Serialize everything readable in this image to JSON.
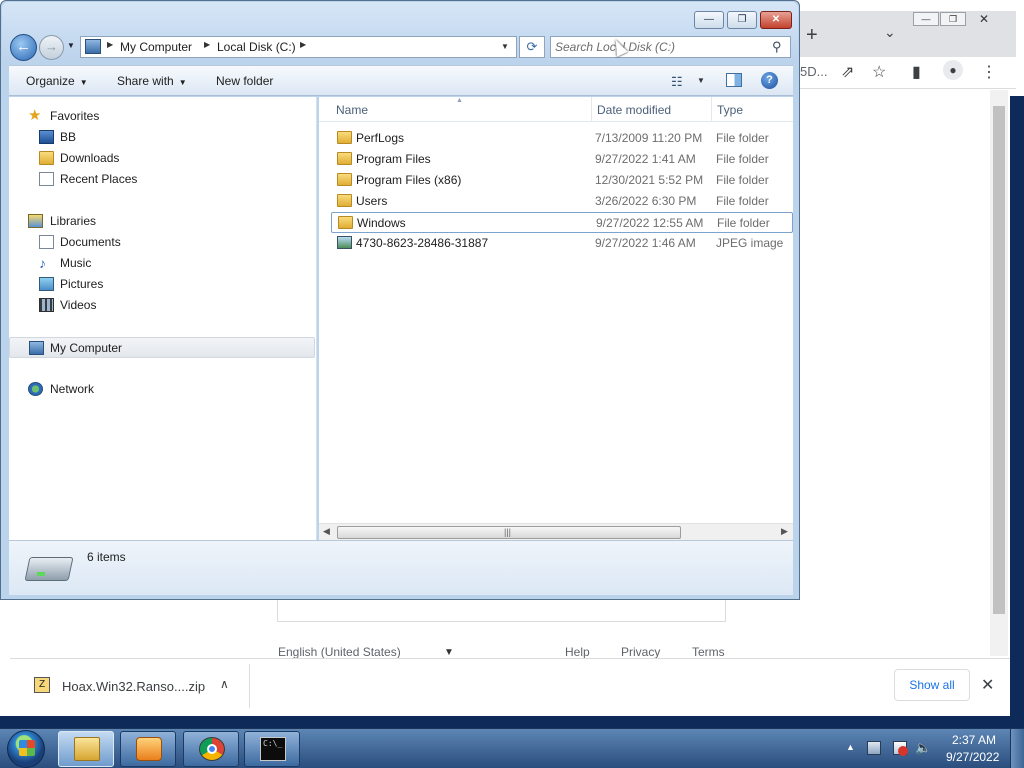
{
  "explorer": {
    "controls": {
      "minimize": "—",
      "maximize": "❐",
      "close": "✕"
    },
    "address": {
      "crumbs": [
        "My Computer",
        "Local Disk (C:)"
      ]
    },
    "search": {
      "placeholder": "Search Local Disk (C:)"
    },
    "toolbar": {
      "organize": "Organize",
      "share_with": "Share with",
      "new_folder": "New folder",
      "help": "?"
    },
    "nav": {
      "favorites": "Favorites",
      "favorites_items": [
        "BB",
        "Downloads",
        "Recent Places"
      ],
      "libraries": "Libraries",
      "libraries_items": [
        "Documents",
        "Music",
        "Pictures",
        "Videos"
      ],
      "computer": "My Computer",
      "network": "Network"
    },
    "columns": {
      "name": "Name",
      "date": "Date modified",
      "type": "Type"
    },
    "files": [
      {
        "name": "PerfLogs",
        "date": "7/13/2009 11:20 PM",
        "type": "File folder"
      },
      {
        "name": "Program Files",
        "date": "9/27/2022 1:41 AM",
        "type": "File folder"
      },
      {
        "name": "Program Files (x86)",
        "date": "12/30/2021 5:52 PM",
        "type": "File folder"
      },
      {
        "name": "Users",
        "date": "3/26/2022 6:30 PM",
        "type": "File folder"
      },
      {
        "name": "Windows",
        "date": "9/27/2022 12:55 AM",
        "type": "File folder"
      },
      {
        "name": "4730-8623-28486-31887",
        "date": "9/27/2022 1:46 AM",
        "type": "JPEG image"
      }
    ],
    "status": {
      "item_count": "6 items"
    }
  },
  "chrome": {
    "url_fragment": "5D...",
    "footer": {
      "language": "English (United States)",
      "help": "Help",
      "privacy": "Privacy",
      "terms": "Terms"
    },
    "downloads": {
      "file_name": "Hoax.Win32.Ranso....zip",
      "show_all": "Show all"
    }
  },
  "taskbar": {
    "time": "2:37 AM",
    "date": "9/27/2022"
  }
}
